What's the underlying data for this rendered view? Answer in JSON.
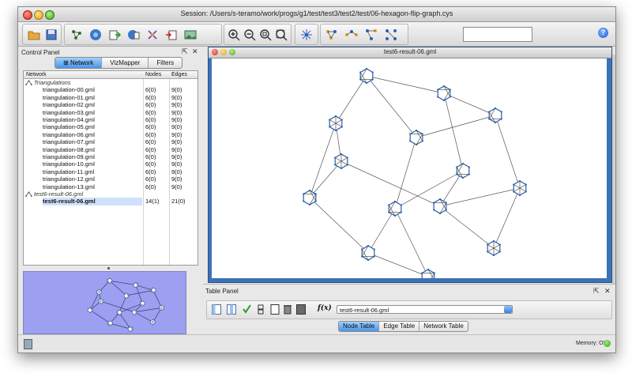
{
  "window": {
    "title": "Session: /Users/s-teramo/work/progs/g1/test/test3/test2/test/06-hexagon-flip-graph.cys"
  },
  "toolbar": {
    "icons": [
      "open-folder-icon",
      "save-icon",
      "layout-icon",
      "network-icon",
      "import-icon",
      "import-table-icon",
      "attribute-icon",
      "export-icon",
      "image-icon",
      "zoom-in-icon",
      "zoom-out-icon",
      "zoom-fit-icon",
      "zoom-selected-icon",
      "network-overview-icon",
      "hide-icon",
      "show-icon",
      "select-first-neighbors-icon",
      "select-nodes-icon"
    ],
    "search_value": "",
    "help_label": "?"
  },
  "control_panel": {
    "title": "Control Panel",
    "tabs": [
      {
        "label": "Network",
        "active": true
      },
      {
        "label": "VizMapper",
        "active": false
      },
      {
        "label": "Filters",
        "active": false
      }
    ],
    "columns": {
      "network": "Network",
      "nodes": "Nodes",
      "edges": "Edges"
    },
    "groups": [
      {
        "name": "Triangulations",
        "items": [
          {
            "name": "triangulation-00.gml",
            "nodes": "6(0)",
            "edges": "9(0)"
          },
          {
            "name": "triangulation-01.gml",
            "nodes": "6(0)",
            "edges": "9(0)"
          },
          {
            "name": "triangulation-02.gml",
            "nodes": "6(0)",
            "edges": "9(0)"
          },
          {
            "name": "triangulation-03.gml",
            "nodes": "6(0)",
            "edges": "9(0)"
          },
          {
            "name": "triangulation-04.gml",
            "nodes": "6(0)",
            "edges": "9(0)"
          },
          {
            "name": "triangulation-05.gml",
            "nodes": "6(0)",
            "edges": "9(0)"
          },
          {
            "name": "triangulation-06.gml",
            "nodes": "6(0)",
            "edges": "9(0)"
          },
          {
            "name": "triangulation-07.gml",
            "nodes": "6(0)",
            "edges": "9(0)"
          },
          {
            "name": "triangulation-08.gml",
            "nodes": "6(0)",
            "edges": "9(0)"
          },
          {
            "name": "triangulation-09.gml",
            "nodes": "6(0)",
            "edges": "9(0)"
          },
          {
            "name": "triangulation-10.gml",
            "nodes": "6(0)",
            "edges": "9(0)"
          },
          {
            "name": "triangulation-11.gml",
            "nodes": "6(0)",
            "edges": "9(0)"
          },
          {
            "name": "triangulation-12.gml",
            "nodes": "6(0)",
            "edges": "9(0)"
          },
          {
            "name": "triangulation-13.gml",
            "nodes": "6(0)",
            "edges": "9(0)"
          }
        ]
      },
      {
        "name": "test6-result-06.gml",
        "items": [
          {
            "name": "test6-result-06.gml",
            "nodes": "14(1)",
            "edges": "21(0)",
            "selected": true
          }
        ]
      }
    ]
  },
  "network_view": {
    "title": "test6-result-06.gml",
    "node_color": "#2b5fa6"
  },
  "table_panel": {
    "title": "Table Panel",
    "fx_label": "f(x)",
    "selected_network": "test6-result-06.gml",
    "tabs": [
      {
        "label": "Node Table",
        "active": true
      },
      {
        "label": "Edge Table",
        "active": false
      },
      {
        "label": "Network Table",
        "active": false
      }
    ]
  },
  "status": {
    "memory": "Memory: OK"
  }
}
